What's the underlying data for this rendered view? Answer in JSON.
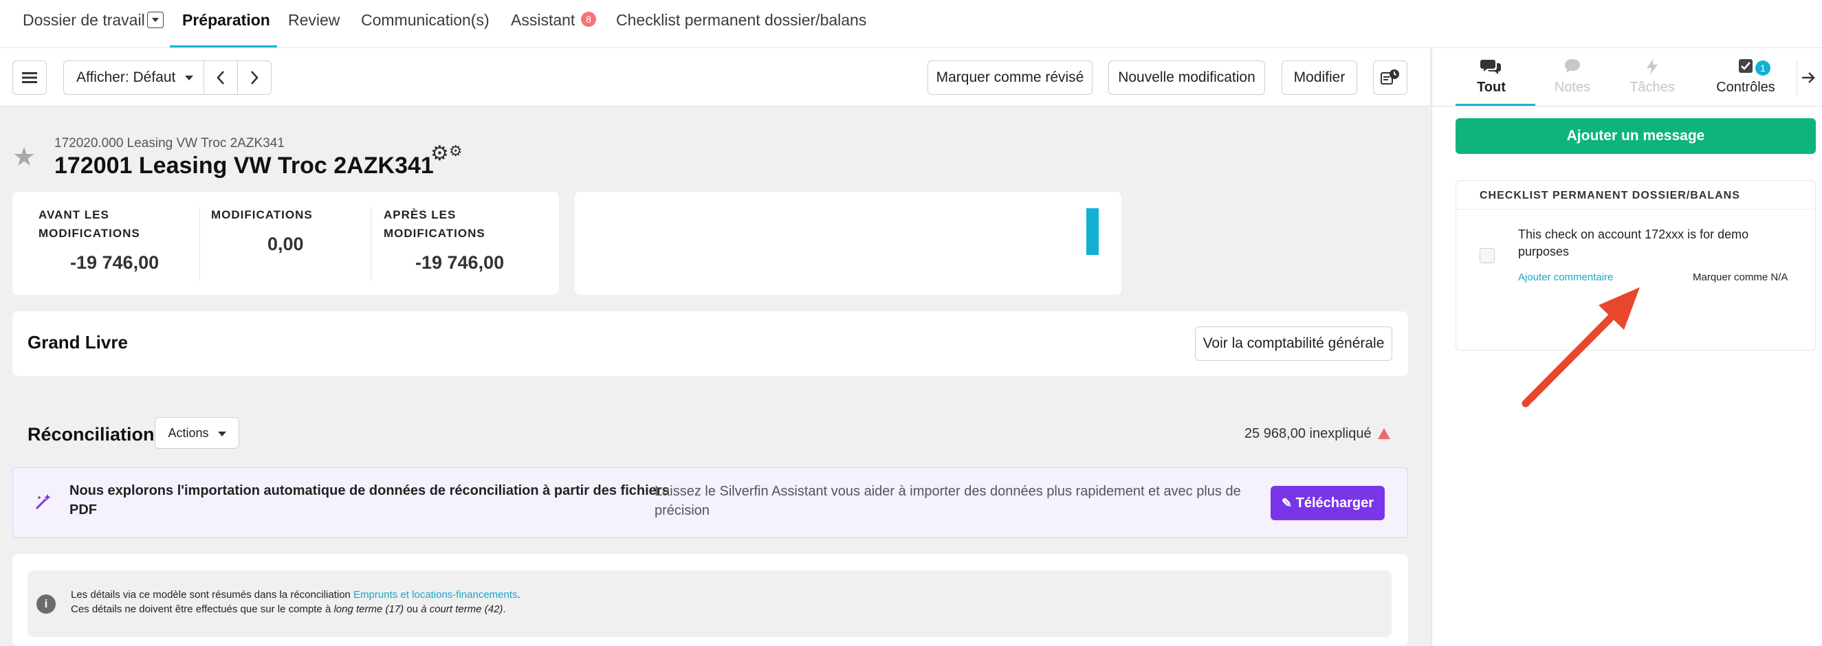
{
  "topnav": {
    "tabs": [
      {
        "label": "Dossier de travail"
      },
      {
        "label": "Préparation"
      },
      {
        "label": "Review"
      },
      {
        "label": "Communication(s)"
      },
      {
        "label": "Assistant"
      },
      {
        "label": "Checklist permanent dossier/balans"
      }
    ],
    "assistant_badge": "8"
  },
  "toolbar": {
    "menu_icon": "hamburger-icon",
    "view_label": "Afficher: Défaut",
    "mark_reviewed": "Marquer comme révisé",
    "new_modification": "Nouvelle modification",
    "modify": "Modifier",
    "history_icon": "history-clock-icon"
  },
  "account": {
    "breadcrumb": "172020.000 Leasing VW Troc 2AZK341",
    "title": "172001 Leasing VW Troc 2AZK341"
  },
  "stats": {
    "before_label_1": "AVANT LES",
    "before_label_2": "MODIFICATIONS",
    "before_value": "-19 746,00",
    "mods_label": "MODIFICATIONS",
    "mods_value": "0,00",
    "after_label_1": "APRÈS LES",
    "after_label_2": "MODIFICATIONS",
    "after_value": "-19 746,00",
    "accent_color": "#12b1d4"
  },
  "grand_livre": {
    "title": "Grand Livre",
    "button": "Voir la comptabilité générale"
  },
  "reconciliation": {
    "title": "Réconciliation",
    "actions": "Actions",
    "unexplained": "25 968,00 inexpliqué"
  },
  "banner": {
    "heading_1": "Nous explorons l'importation automatique de données de réconciliation à partir des fichiers",
    "heading_2": "PDF",
    "desc_1": "Laissez le Silverfin Assistant vous aider à importer des données plus rapidement et avec plus de",
    "desc_2": "précision",
    "button": "Télécharger"
  },
  "info": {
    "line1_prefix": "Les détails via ce modèle sont résumés dans la réconciliation ",
    "line1_link": "Emprunts et locations-financements",
    "line1_suffix": ".",
    "line2_a": "Ces détails ne doivent être effectués que sur le compte à ",
    "line2_b": "long terme (17)",
    "line2_c": " ou ",
    "line2_d": "à court terme (42)",
    "line2_e": "."
  },
  "right_panel": {
    "tabs": [
      {
        "label": "Tout"
      },
      {
        "label": "Notes"
      },
      {
        "label": "Tâches"
      },
      {
        "label": "Contrôles"
      }
    ],
    "controls_badge": "1",
    "add_message": "Ajouter un message",
    "checklist_title": "CHECKLIST PERMANENT DOSSIER/BALANS",
    "check_text_1": "This check on account 172xxx is for demo",
    "check_text_2": "purposes",
    "add_comment": "Ajouter commentaire",
    "mark_na": "Marquer comme N/A"
  },
  "colors": {
    "accent": "#1cb1d6",
    "green": "#0fb47c",
    "purple": "#7b35e8",
    "arrow": "#e8472d"
  }
}
